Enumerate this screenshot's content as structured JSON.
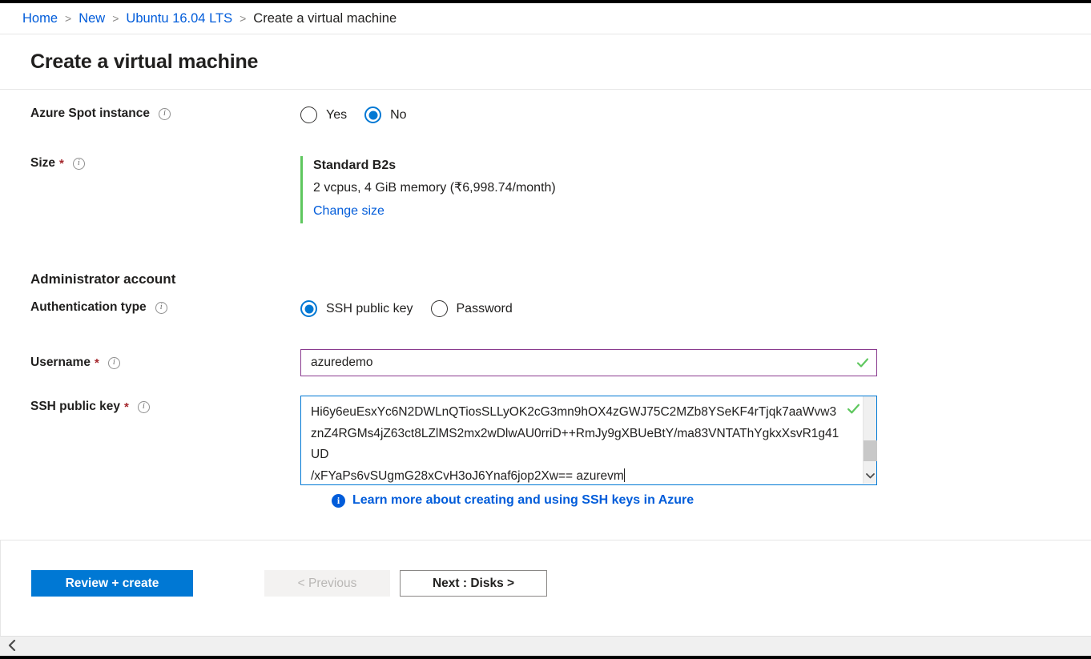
{
  "breadcrumb": {
    "items": [
      {
        "label": "Home",
        "link": true
      },
      {
        "label": "New",
        "link": true
      },
      {
        "label": "Ubuntu 16.04 LTS",
        "link": true
      },
      {
        "label": "Create a virtual machine",
        "link": false
      }
    ],
    "separator": ">"
  },
  "blade": {
    "title": "Create a virtual machine"
  },
  "spot": {
    "label": "Azure Spot instance",
    "info_icon": "info-icon",
    "options": [
      {
        "label": "Yes",
        "selected": false
      },
      {
        "label": "No",
        "selected": true
      }
    ]
  },
  "size": {
    "label": "Size",
    "required": "*",
    "info_icon": "info-icon",
    "name": "Standard B2s",
    "description": "2 vcpus, 4 GiB memory (₹6,998.74/month)",
    "change_link": "Change size",
    "accent_color": "#5ec75e"
  },
  "admin": {
    "section_title": "Administrator account",
    "auth": {
      "label": "Authentication type",
      "info_icon": "info-icon",
      "options": [
        {
          "label": "SSH public key",
          "selected": true
        },
        {
          "label": "Password",
          "selected": false
        }
      ]
    },
    "username": {
      "label": "Username",
      "required": "*",
      "info_icon": "info-icon",
      "value": "azuredemo",
      "placeholder": "",
      "valid": true,
      "border_color": "#8a3b8f"
    },
    "ssh_key": {
      "label": "SSH public key",
      "required": "*",
      "info_icon": "info-icon",
      "value": "Hi6y6euEsxYc6N2DWLnQTiosSLLyOK2cG3mn9hOX4zGWJ75C2MZb8YSeKF4rTjqk7aaWvw3znZ4RGMs4jZ63ct8LZlMS2mx2wDlwAU0rriD++RmJy9gXBUeBtY/ma83VNTAThYgkxXsvR1g41UD\n/xFYaPs6vSUgmG28xCvH3oJ6Ynaf6jop2Xw== azurevm",
      "placeholder": "",
      "valid": true,
      "border_color": "#0078d4",
      "scroll_down_icon": "chevron-down-icon"
    },
    "learn_more": {
      "icon": "info-circle-icon",
      "text": "Learn more about creating and using SSH keys in Azure"
    }
  },
  "footer": {
    "review_create": "Review + create",
    "previous": "< Previous",
    "next": "Next : Disks >"
  },
  "bottom_bar": {
    "collapse_icon": "chevron-left-icon",
    "collapse_label": "‹"
  },
  "colors": {
    "link": "#015cda",
    "primary": "#0078d4",
    "valid": "#5ec75e",
    "required": "#a4262c"
  }
}
